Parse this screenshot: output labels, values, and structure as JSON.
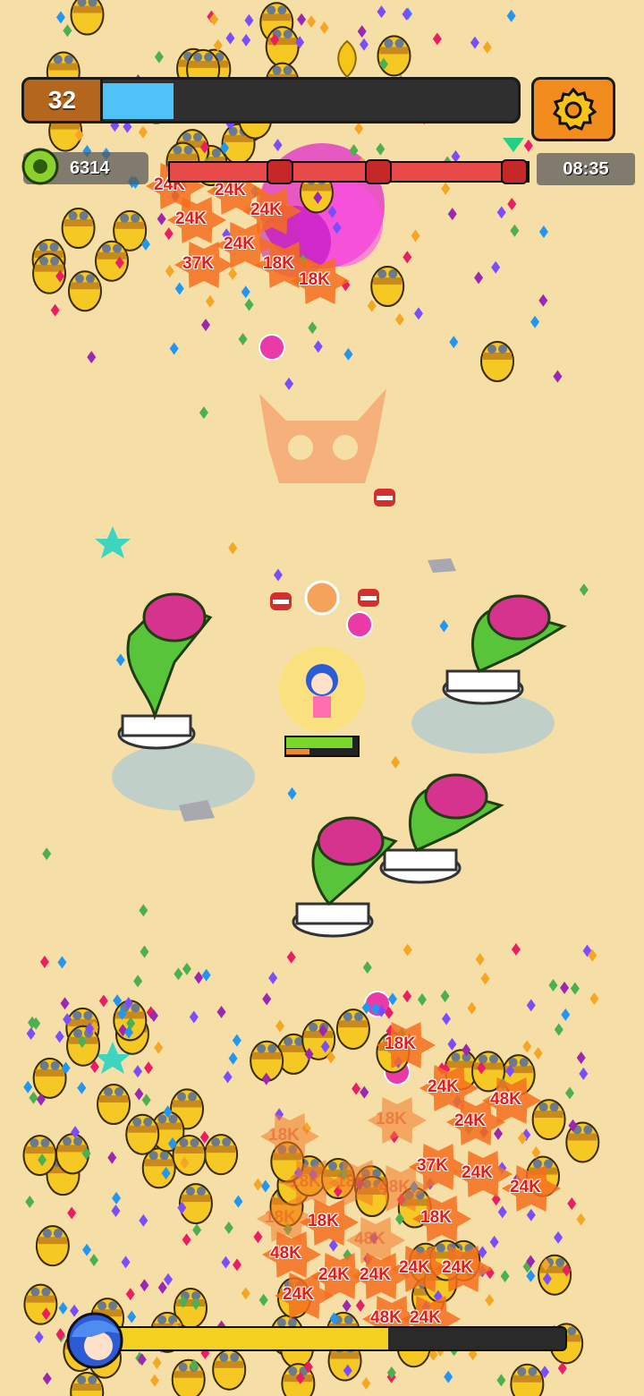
{
  "hud": {
    "level": "32",
    "xp_progress": 0.17,
    "coins": "6314",
    "timer": "08:35",
    "boss_progress": 0.97,
    "bottom_progress": 0.62,
    "hero_hp": 0.93
  },
  "icons": {
    "settings": "gear-icon",
    "coins": "gear-coin-icon",
    "boss": "demon-skull-icon",
    "hero": "hero-avatar-icon"
  },
  "colors": {
    "background": "#f6dfa6",
    "xp": "#4fc3f7",
    "boss": "#e84a4a",
    "bottom": "#f4d021",
    "hp": "#7bd62a",
    "settings": "#f28c1c"
  },
  "damage_numbers": [
    {
      "text": "24K",
      "faded": false
    },
    {
      "text": "24K",
      "faded": false
    },
    {
      "text": "24K",
      "faded": false
    },
    {
      "text": "24K",
      "faded": false
    },
    {
      "text": "24K",
      "faded": false
    },
    {
      "text": "37K",
      "faded": false
    },
    {
      "text": "18K",
      "faded": false
    },
    {
      "text": "18K",
      "faded": false
    },
    {
      "text": "18K",
      "faded": false
    },
    {
      "text": "24K",
      "faded": false
    },
    {
      "text": "48K",
      "faded": false
    },
    {
      "text": "24K",
      "faded": false
    },
    {
      "text": "18K",
      "faded": true
    },
    {
      "text": "18K",
      "faded": true
    },
    {
      "text": "18K",
      "faded": true
    },
    {
      "text": "18K",
      "faded": true
    },
    {
      "text": "48K",
      "faded": true
    },
    {
      "text": "37K",
      "faded": false
    },
    {
      "text": "24K",
      "faded": false
    },
    {
      "text": "24K",
      "faded": false
    },
    {
      "text": "18K",
      "faded": true
    },
    {
      "text": "18K",
      "faded": false
    },
    {
      "text": "48K",
      "faded": true
    },
    {
      "text": "18K",
      "faded": false
    },
    {
      "text": "48K",
      "faded": false
    },
    {
      "text": "24K",
      "faded": false
    },
    {
      "text": "24K",
      "faded": false
    },
    {
      "text": "24K",
      "faded": false
    },
    {
      "text": "24K",
      "faded": false
    },
    {
      "text": "24K",
      "faded": false
    },
    {
      "text": "48K",
      "faded": false
    },
    {
      "text": "24K",
      "faded": false
    }
  ]
}
